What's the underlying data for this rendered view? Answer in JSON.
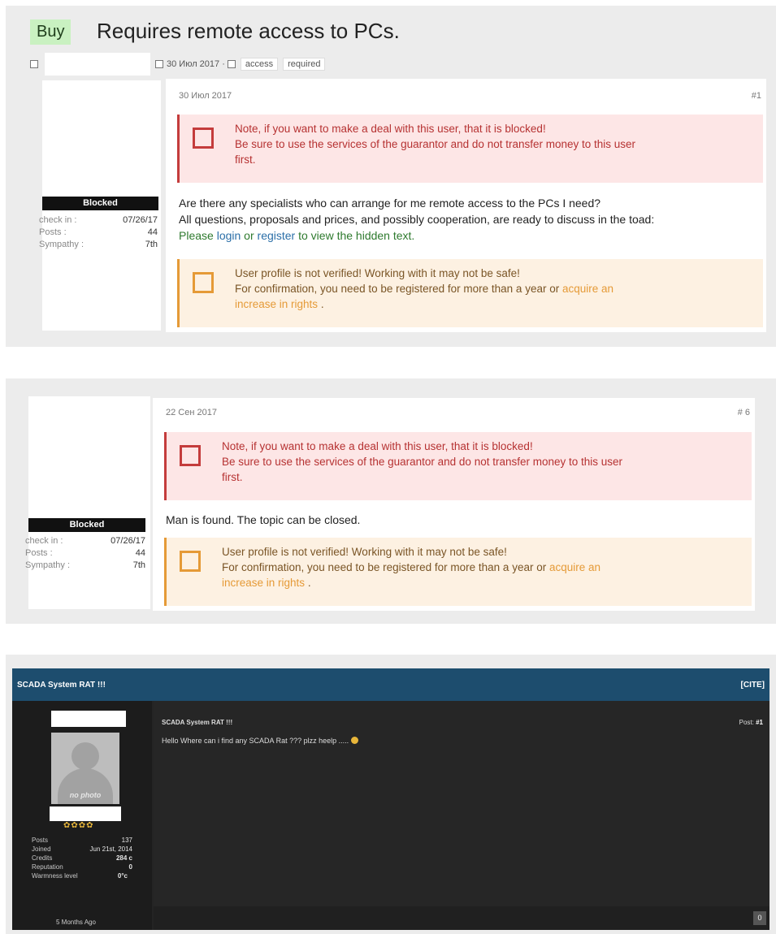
{
  "thread1": {
    "prefix": "Buy",
    "title": "Requires remote access to PCs.",
    "meta_date": "30 Июл 2017 ·",
    "tags": [
      "access",
      "required"
    ],
    "user": {
      "status": "Blocked",
      "stats": [
        {
          "label": "check in :",
          "value": "07/26/17"
        },
        {
          "label": "Posts :",
          "value": "44"
        },
        {
          "label": "Sympathy :",
          "value": "7th"
        }
      ]
    },
    "post": {
      "date": "30 Июл 2017",
      "number": "#1",
      "warning_lines": [
        "Note, if you want to make a deal with this user, that it is blocked!",
        "Be sure to use the services of the guarantor and do not transfer money to this user",
        "first."
      ],
      "message_lines": [
        "Are there any specialists who can arrange for me remote access to the PCs I need?",
        "All questions, proposals and prices, and possibly cooperation, are ready to discuss in the toad:"
      ],
      "hidden": {
        "pre": "Please ",
        "login": "login",
        "or": " or ",
        "register": "register",
        "post": " to view the hidden text."
      },
      "notice": {
        "line1": "User profile is not verified! Working with it may not be safe!",
        "line2_pre": "For confirmation, you need to be registered for more than a year or ",
        "line2_link": "acquire an",
        "line3_link": "increase in rights",
        "line3_post": " ."
      }
    }
  },
  "thread2": {
    "user": {
      "status": "Blocked",
      "stats": [
        {
          "label": "check in :",
          "value": "07/26/17"
        },
        {
          "label": "Posts :",
          "value": "44"
        },
        {
          "label": "Sympathy :",
          "value": "7th"
        }
      ]
    },
    "post": {
      "date": "22 Сен 2017",
      "number": "# 6",
      "warning_lines": [
        "Note, if you want to make a deal with this user, that it is blocked!",
        "Be sure to use the services of the guarantor and do not transfer money to this user",
        "first."
      ],
      "message": "Man is found. The topic can be closed.",
      "notice": {
        "line1": "User profile is not verified! Working with it may not be safe!",
        "line2_pre": "For confirmation, you need to be registered for more than a year or ",
        "line2_link": "acquire an",
        "line3_link": "increase in rights",
        "line3_post": " ."
      }
    }
  },
  "thread3": {
    "header_title": "SCADA System RAT !!!",
    "cite": "[CITE]",
    "avatar_label": "no photo",
    "stars": "✿✿✿✿",
    "stats": [
      {
        "label": "Posts",
        "value": "137"
      },
      {
        "label": "Joined",
        "value": "Jun 21st, 2014"
      },
      {
        "label": "Credits",
        "value": "284 c"
      },
      {
        "label": "Reputation",
        "value": "0"
      },
      {
        "label": "Warmness level",
        "value": "0°c"
      }
    ],
    "subject": "SCADA System RAT !!!",
    "message": "Hello Where can i find any SCADA Rat ??? plzz heelp .....",
    "post_label": "Post:",
    "post_number": "#1",
    "time_ago": "5 Months Ago",
    "count": "0"
  }
}
